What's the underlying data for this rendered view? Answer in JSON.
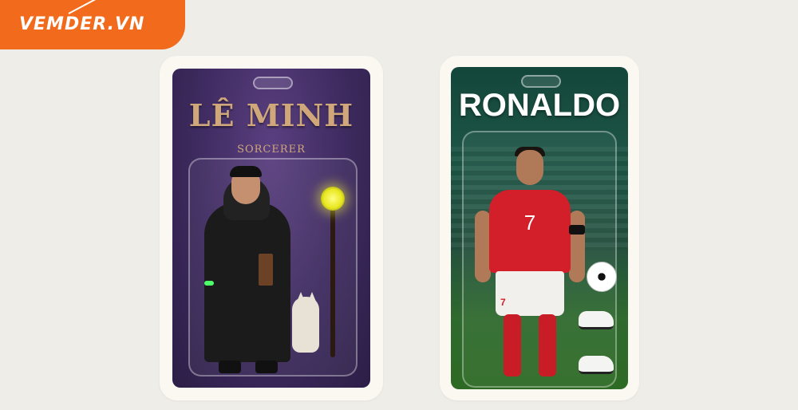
{
  "logo": {
    "text": "VEMDER.VN"
  },
  "cards": [
    {
      "title": "LÊ MINH",
      "subtitle": "SORCERER",
      "accent_color": "#cfa77a",
      "background_color": "#3d2a5e",
      "accessories": [
        "staff-with-glowing-orb",
        "book",
        "white-fox"
      ]
    },
    {
      "title": "RONALDO",
      "shirt_number": "7",
      "armband": "C",
      "accent_color": "#ffffff",
      "background_color": "#1d5646",
      "accessories": [
        "soccer-ball",
        "football-boots",
        "football-boots"
      ]
    }
  ],
  "colors": {
    "brand": "#f26a1b",
    "page_background": "#efede8"
  }
}
